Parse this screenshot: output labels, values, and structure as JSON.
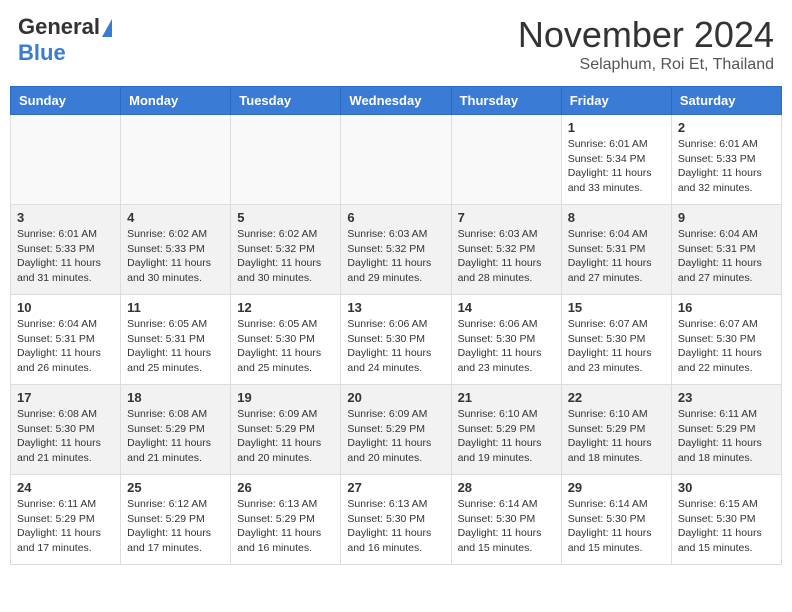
{
  "header": {
    "logo_general": "General",
    "logo_blue": "Blue",
    "month_title": "November 2024",
    "subtitle": "Selaphum, Roi Et, Thailand"
  },
  "days_of_week": [
    "Sunday",
    "Monday",
    "Tuesday",
    "Wednesday",
    "Thursday",
    "Friday",
    "Saturday"
  ],
  "weeks": [
    {
      "alt": false,
      "days": [
        {
          "num": "",
          "info": ""
        },
        {
          "num": "",
          "info": ""
        },
        {
          "num": "",
          "info": ""
        },
        {
          "num": "",
          "info": ""
        },
        {
          "num": "",
          "info": ""
        },
        {
          "num": "1",
          "info": "Sunrise: 6:01 AM\nSunset: 5:34 PM\nDaylight: 11 hours and 33 minutes."
        },
        {
          "num": "2",
          "info": "Sunrise: 6:01 AM\nSunset: 5:33 PM\nDaylight: 11 hours and 32 minutes."
        }
      ]
    },
    {
      "alt": true,
      "days": [
        {
          "num": "3",
          "info": "Sunrise: 6:01 AM\nSunset: 5:33 PM\nDaylight: 11 hours and 31 minutes."
        },
        {
          "num": "4",
          "info": "Sunrise: 6:02 AM\nSunset: 5:33 PM\nDaylight: 11 hours and 30 minutes."
        },
        {
          "num": "5",
          "info": "Sunrise: 6:02 AM\nSunset: 5:32 PM\nDaylight: 11 hours and 30 minutes."
        },
        {
          "num": "6",
          "info": "Sunrise: 6:03 AM\nSunset: 5:32 PM\nDaylight: 11 hours and 29 minutes."
        },
        {
          "num": "7",
          "info": "Sunrise: 6:03 AM\nSunset: 5:32 PM\nDaylight: 11 hours and 28 minutes."
        },
        {
          "num": "8",
          "info": "Sunrise: 6:04 AM\nSunset: 5:31 PM\nDaylight: 11 hours and 27 minutes."
        },
        {
          "num": "9",
          "info": "Sunrise: 6:04 AM\nSunset: 5:31 PM\nDaylight: 11 hours and 27 minutes."
        }
      ]
    },
    {
      "alt": false,
      "days": [
        {
          "num": "10",
          "info": "Sunrise: 6:04 AM\nSunset: 5:31 PM\nDaylight: 11 hours and 26 minutes."
        },
        {
          "num": "11",
          "info": "Sunrise: 6:05 AM\nSunset: 5:31 PM\nDaylight: 11 hours and 25 minutes."
        },
        {
          "num": "12",
          "info": "Sunrise: 6:05 AM\nSunset: 5:30 PM\nDaylight: 11 hours and 25 minutes."
        },
        {
          "num": "13",
          "info": "Sunrise: 6:06 AM\nSunset: 5:30 PM\nDaylight: 11 hours and 24 minutes."
        },
        {
          "num": "14",
          "info": "Sunrise: 6:06 AM\nSunset: 5:30 PM\nDaylight: 11 hours and 23 minutes."
        },
        {
          "num": "15",
          "info": "Sunrise: 6:07 AM\nSunset: 5:30 PM\nDaylight: 11 hours and 23 minutes."
        },
        {
          "num": "16",
          "info": "Sunrise: 6:07 AM\nSunset: 5:30 PM\nDaylight: 11 hours and 22 minutes."
        }
      ]
    },
    {
      "alt": true,
      "days": [
        {
          "num": "17",
          "info": "Sunrise: 6:08 AM\nSunset: 5:30 PM\nDaylight: 11 hours and 21 minutes."
        },
        {
          "num": "18",
          "info": "Sunrise: 6:08 AM\nSunset: 5:29 PM\nDaylight: 11 hours and 21 minutes."
        },
        {
          "num": "19",
          "info": "Sunrise: 6:09 AM\nSunset: 5:29 PM\nDaylight: 11 hours and 20 minutes."
        },
        {
          "num": "20",
          "info": "Sunrise: 6:09 AM\nSunset: 5:29 PM\nDaylight: 11 hours and 20 minutes."
        },
        {
          "num": "21",
          "info": "Sunrise: 6:10 AM\nSunset: 5:29 PM\nDaylight: 11 hours and 19 minutes."
        },
        {
          "num": "22",
          "info": "Sunrise: 6:10 AM\nSunset: 5:29 PM\nDaylight: 11 hours and 18 minutes."
        },
        {
          "num": "23",
          "info": "Sunrise: 6:11 AM\nSunset: 5:29 PM\nDaylight: 11 hours and 18 minutes."
        }
      ]
    },
    {
      "alt": false,
      "days": [
        {
          "num": "24",
          "info": "Sunrise: 6:11 AM\nSunset: 5:29 PM\nDaylight: 11 hours and 17 minutes."
        },
        {
          "num": "25",
          "info": "Sunrise: 6:12 AM\nSunset: 5:29 PM\nDaylight: 11 hours and 17 minutes."
        },
        {
          "num": "26",
          "info": "Sunrise: 6:13 AM\nSunset: 5:29 PM\nDaylight: 11 hours and 16 minutes."
        },
        {
          "num": "27",
          "info": "Sunrise: 6:13 AM\nSunset: 5:30 PM\nDaylight: 11 hours and 16 minutes."
        },
        {
          "num": "28",
          "info": "Sunrise: 6:14 AM\nSunset: 5:30 PM\nDaylight: 11 hours and 15 minutes."
        },
        {
          "num": "29",
          "info": "Sunrise: 6:14 AM\nSunset: 5:30 PM\nDaylight: 11 hours and 15 minutes."
        },
        {
          "num": "30",
          "info": "Sunrise: 6:15 AM\nSunset: 5:30 PM\nDaylight: 11 hours and 15 minutes."
        }
      ]
    }
  ]
}
